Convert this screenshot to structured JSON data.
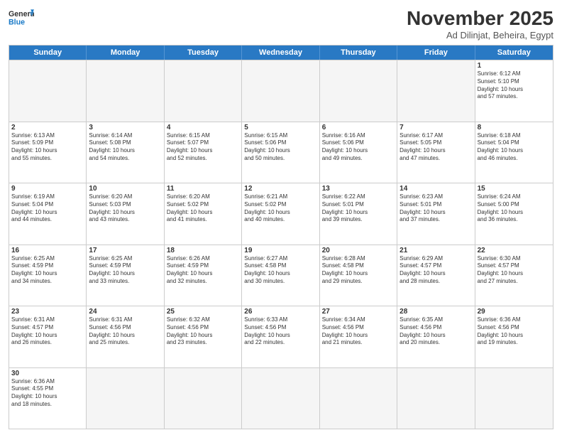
{
  "header": {
    "logo_general": "General",
    "logo_blue": "Blue",
    "title": "November 2025",
    "location": "Ad Dilinjat, Beheira, Egypt"
  },
  "weekdays": [
    "Sunday",
    "Monday",
    "Tuesday",
    "Wednesday",
    "Thursday",
    "Friday",
    "Saturday"
  ],
  "rows": [
    [
      {
        "day": "",
        "text": "",
        "empty": true
      },
      {
        "day": "",
        "text": "",
        "empty": true
      },
      {
        "day": "",
        "text": "",
        "empty": true
      },
      {
        "day": "",
        "text": "",
        "empty": true
      },
      {
        "day": "",
        "text": "",
        "empty": true
      },
      {
        "day": "",
        "text": "",
        "empty": true
      },
      {
        "day": "1",
        "text": "Sunrise: 6:12 AM\nSunset: 5:10 PM\nDaylight: 10 hours\nand 57 minutes.",
        "empty": false
      }
    ],
    [
      {
        "day": "2",
        "text": "Sunrise: 6:13 AM\nSunset: 5:09 PM\nDaylight: 10 hours\nand 55 minutes.",
        "empty": false
      },
      {
        "day": "3",
        "text": "Sunrise: 6:14 AM\nSunset: 5:08 PM\nDaylight: 10 hours\nand 54 minutes.",
        "empty": false
      },
      {
        "day": "4",
        "text": "Sunrise: 6:15 AM\nSunset: 5:07 PM\nDaylight: 10 hours\nand 52 minutes.",
        "empty": false
      },
      {
        "day": "5",
        "text": "Sunrise: 6:15 AM\nSunset: 5:06 PM\nDaylight: 10 hours\nand 50 minutes.",
        "empty": false
      },
      {
        "day": "6",
        "text": "Sunrise: 6:16 AM\nSunset: 5:06 PM\nDaylight: 10 hours\nand 49 minutes.",
        "empty": false
      },
      {
        "day": "7",
        "text": "Sunrise: 6:17 AM\nSunset: 5:05 PM\nDaylight: 10 hours\nand 47 minutes.",
        "empty": false
      },
      {
        "day": "8",
        "text": "Sunrise: 6:18 AM\nSunset: 5:04 PM\nDaylight: 10 hours\nand 46 minutes.",
        "empty": false
      }
    ],
    [
      {
        "day": "9",
        "text": "Sunrise: 6:19 AM\nSunset: 5:04 PM\nDaylight: 10 hours\nand 44 minutes.",
        "empty": false
      },
      {
        "day": "10",
        "text": "Sunrise: 6:20 AM\nSunset: 5:03 PM\nDaylight: 10 hours\nand 43 minutes.",
        "empty": false
      },
      {
        "day": "11",
        "text": "Sunrise: 6:20 AM\nSunset: 5:02 PM\nDaylight: 10 hours\nand 41 minutes.",
        "empty": false
      },
      {
        "day": "12",
        "text": "Sunrise: 6:21 AM\nSunset: 5:02 PM\nDaylight: 10 hours\nand 40 minutes.",
        "empty": false
      },
      {
        "day": "13",
        "text": "Sunrise: 6:22 AM\nSunset: 5:01 PM\nDaylight: 10 hours\nand 39 minutes.",
        "empty": false
      },
      {
        "day": "14",
        "text": "Sunrise: 6:23 AM\nSunset: 5:01 PM\nDaylight: 10 hours\nand 37 minutes.",
        "empty": false
      },
      {
        "day": "15",
        "text": "Sunrise: 6:24 AM\nSunset: 5:00 PM\nDaylight: 10 hours\nand 36 minutes.",
        "empty": false
      }
    ],
    [
      {
        "day": "16",
        "text": "Sunrise: 6:25 AM\nSunset: 4:59 PM\nDaylight: 10 hours\nand 34 minutes.",
        "empty": false
      },
      {
        "day": "17",
        "text": "Sunrise: 6:25 AM\nSunset: 4:59 PM\nDaylight: 10 hours\nand 33 minutes.",
        "empty": false
      },
      {
        "day": "18",
        "text": "Sunrise: 6:26 AM\nSunset: 4:59 PM\nDaylight: 10 hours\nand 32 minutes.",
        "empty": false
      },
      {
        "day": "19",
        "text": "Sunrise: 6:27 AM\nSunset: 4:58 PM\nDaylight: 10 hours\nand 30 minutes.",
        "empty": false
      },
      {
        "day": "20",
        "text": "Sunrise: 6:28 AM\nSunset: 4:58 PM\nDaylight: 10 hours\nand 29 minutes.",
        "empty": false
      },
      {
        "day": "21",
        "text": "Sunrise: 6:29 AM\nSunset: 4:57 PM\nDaylight: 10 hours\nand 28 minutes.",
        "empty": false
      },
      {
        "day": "22",
        "text": "Sunrise: 6:30 AM\nSunset: 4:57 PM\nDaylight: 10 hours\nand 27 minutes.",
        "empty": false
      }
    ],
    [
      {
        "day": "23",
        "text": "Sunrise: 6:31 AM\nSunset: 4:57 PM\nDaylight: 10 hours\nand 26 minutes.",
        "empty": false
      },
      {
        "day": "24",
        "text": "Sunrise: 6:31 AM\nSunset: 4:56 PM\nDaylight: 10 hours\nand 25 minutes.",
        "empty": false
      },
      {
        "day": "25",
        "text": "Sunrise: 6:32 AM\nSunset: 4:56 PM\nDaylight: 10 hours\nand 23 minutes.",
        "empty": false
      },
      {
        "day": "26",
        "text": "Sunrise: 6:33 AM\nSunset: 4:56 PM\nDaylight: 10 hours\nand 22 minutes.",
        "empty": false
      },
      {
        "day": "27",
        "text": "Sunrise: 6:34 AM\nSunset: 4:56 PM\nDaylight: 10 hours\nand 21 minutes.",
        "empty": false
      },
      {
        "day": "28",
        "text": "Sunrise: 6:35 AM\nSunset: 4:56 PM\nDaylight: 10 hours\nand 20 minutes.",
        "empty": false
      },
      {
        "day": "29",
        "text": "Sunrise: 6:36 AM\nSunset: 4:56 PM\nDaylight: 10 hours\nand 19 minutes.",
        "empty": false
      }
    ],
    [
      {
        "day": "30",
        "text": "Sunrise: 6:36 AM\nSunset: 4:55 PM\nDaylight: 10 hours\nand 18 minutes.",
        "empty": false
      },
      {
        "day": "",
        "text": "",
        "empty": true
      },
      {
        "day": "",
        "text": "",
        "empty": true
      },
      {
        "day": "",
        "text": "",
        "empty": true
      },
      {
        "day": "",
        "text": "",
        "empty": true
      },
      {
        "day": "",
        "text": "",
        "empty": true
      },
      {
        "day": "",
        "text": "",
        "empty": true
      }
    ]
  ]
}
